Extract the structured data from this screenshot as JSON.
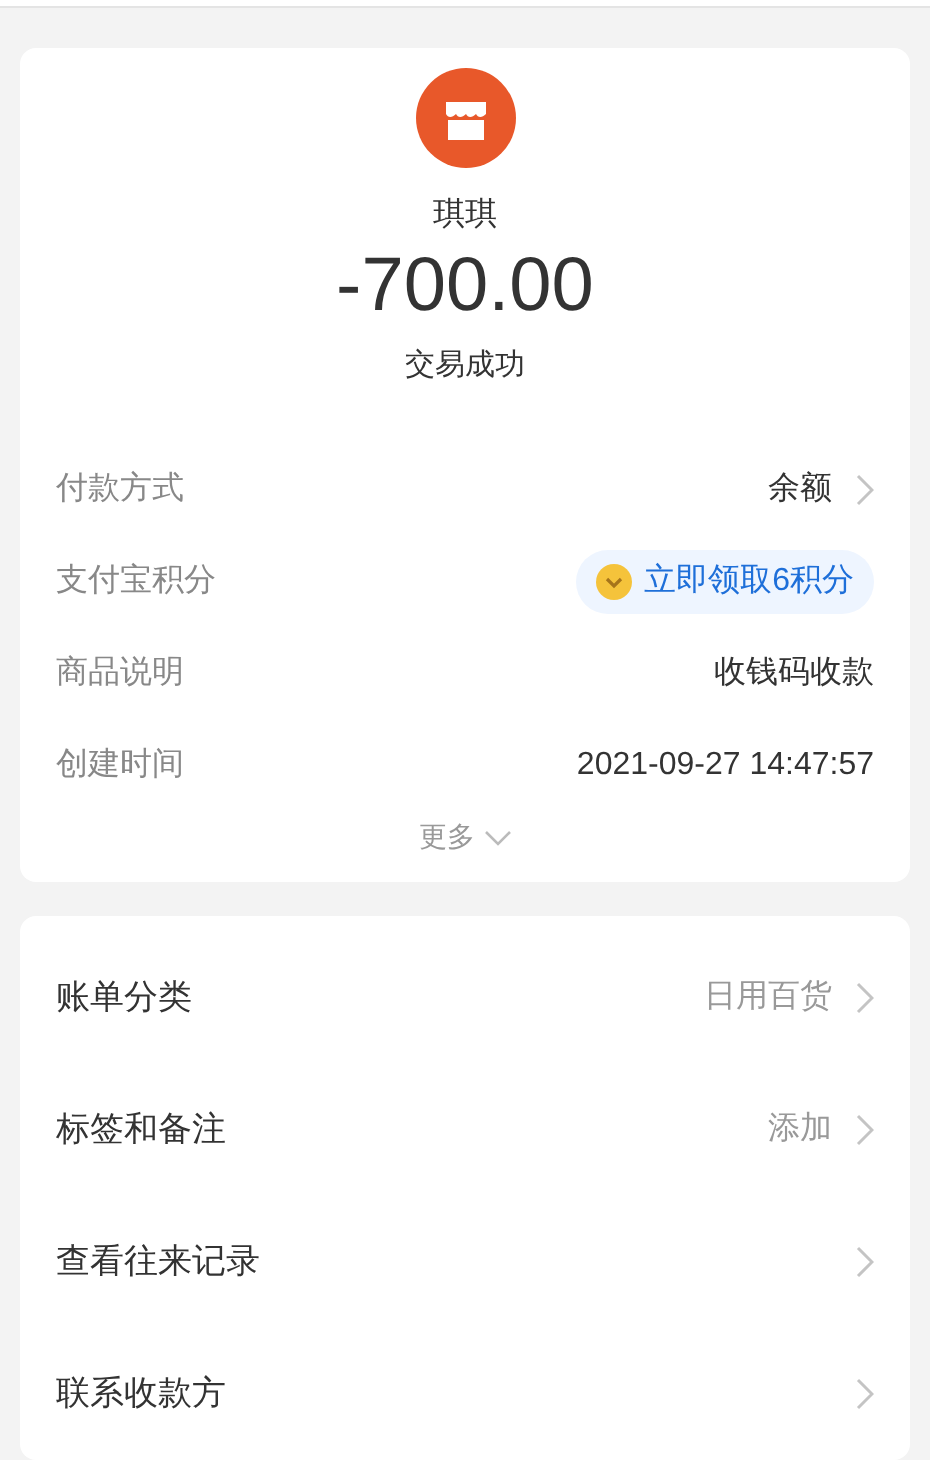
{
  "payee": {
    "name": "琪琪",
    "amount": "-700.00",
    "status": "交易成功"
  },
  "details": [
    {
      "kind": "link",
      "label": "付款方式",
      "value": "余额"
    },
    {
      "kind": "badge",
      "label": "支付宝积分",
      "value": "立即领取6积分"
    },
    {
      "kind": "plain",
      "label": "商品说明",
      "value": "收钱码收款"
    },
    {
      "kind": "plain",
      "label": "创建时间",
      "value": "2021-09-27 14:47:57"
    }
  ],
  "more": "更多",
  "actions": [
    {
      "label": "账单分类",
      "value": "日用百货"
    },
    {
      "label": "标签和备注",
      "value": "添加"
    },
    {
      "label": "查看往来记录"
    },
    {
      "label": "联系收款方"
    }
  ]
}
